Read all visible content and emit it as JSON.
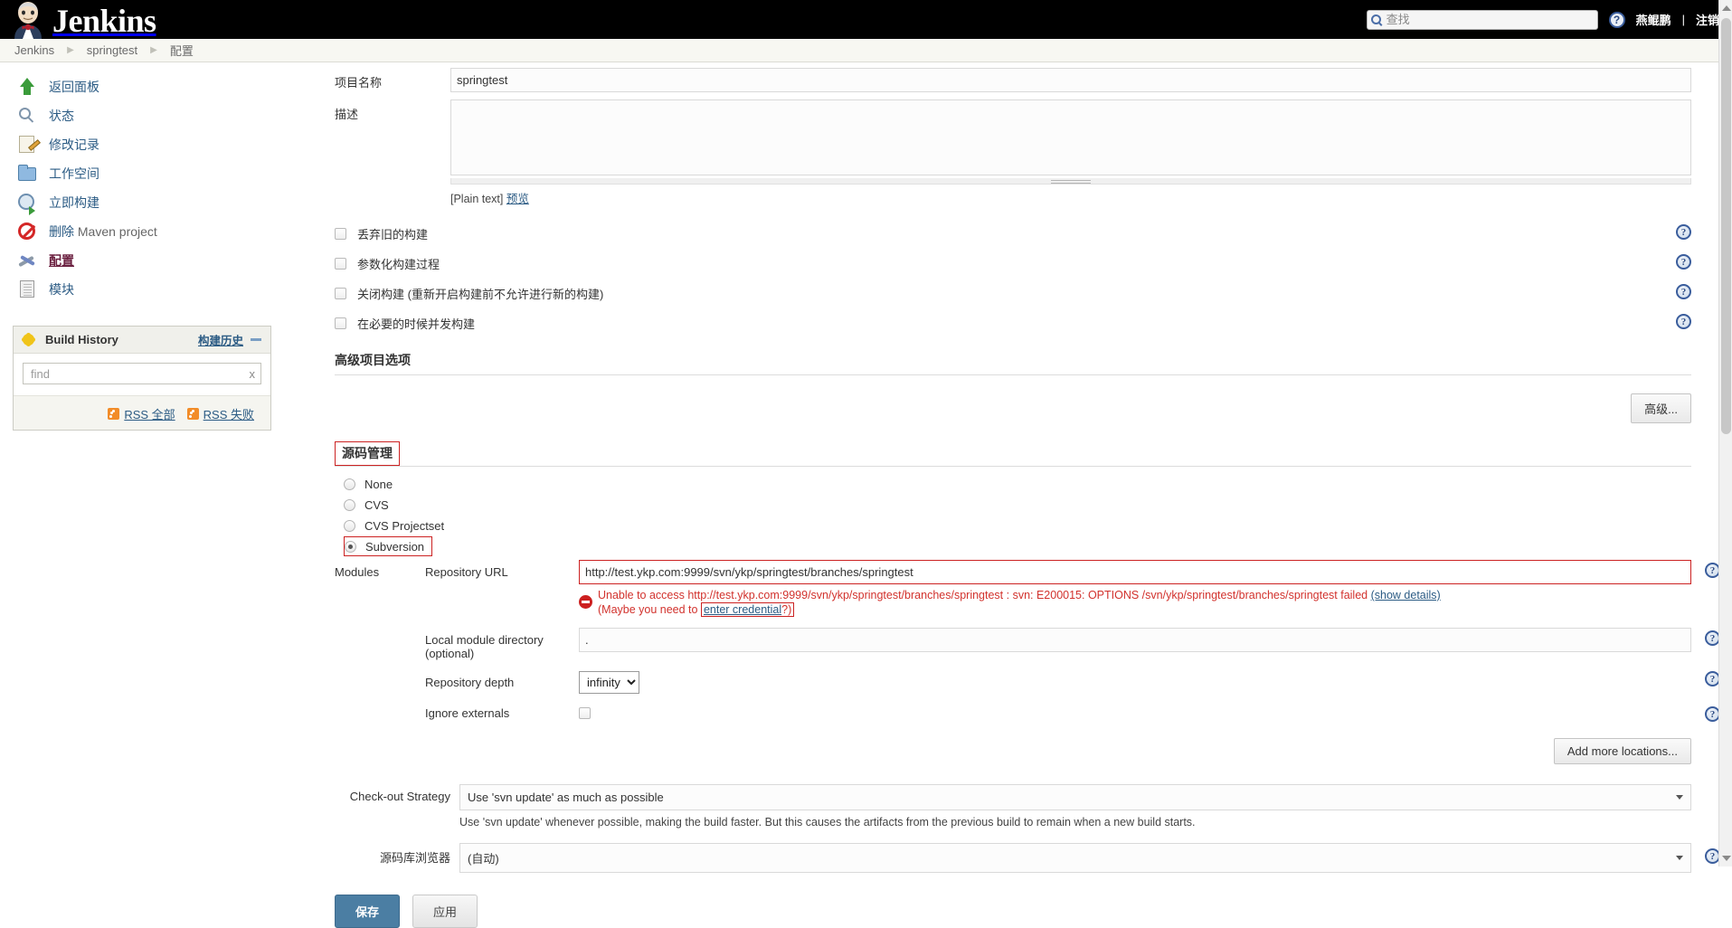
{
  "header": {
    "brand": "Jenkins",
    "search_placeholder": "查找",
    "search_value": "",
    "help_icon": "help-icon",
    "user": "燕鲲鹏",
    "separator": "|",
    "logout": "注销"
  },
  "breadcrumb": {
    "items": [
      "Jenkins",
      "springtest",
      "配置"
    ]
  },
  "sidebar": {
    "items": [
      {
        "label": "返回面板",
        "icon": "up-arrow-icon",
        "current": false
      },
      {
        "label": "状态",
        "icon": "search-icon",
        "current": false
      },
      {
        "label": "修改记录",
        "icon": "changes-icon",
        "current": false
      },
      {
        "label": "工作空间",
        "icon": "folder-icon",
        "current": false
      },
      {
        "label": "立即构建",
        "icon": "build-now-icon",
        "current": false
      },
      {
        "label": "删除",
        "sub": "Maven project",
        "icon": "delete-icon",
        "current": false
      },
      {
        "label": "配置",
        "icon": "wrench-icon",
        "current": true
      },
      {
        "label": "模块",
        "icon": "module-icon",
        "current": false
      }
    ],
    "build_history": {
      "title": "Build History",
      "link": "构建历史",
      "find_placeholder": "find",
      "find_value": "",
      "clear_label": "x",
      "rss_all": "RSS 全部",
      "rss_failed": "RSS 失败"
    }
  },
  "form": {
    "project_name_label": "项目名称",
    "project_name_value": "springtest",
    "description_label": "描述",
    "description_value": "",
    "plain_text_note": "[Plain text]",
    "preview_link": "预览",
    "checkboxes": [
      {
        "label": "丢弃旧的构建",
        "checked": false
      },
      {
        "label": "参数化构建过程",
        "checked": false
      },
      {
        "label": "关闭构建 (重新开启构建前不允许进行新的构建)",
        "checked": false
      },
      {
        "label": "在必要的时候并发构建",
        "checked": false
      }
    ],
    "advanced_section_title": "高级项目选项",
    "advanced_button": "高级...",
    "scm": {
      "title": "源码管理",
      "options": [
        {
          "label": "None",
          "selected": false
        },
        {
          "label": "CVS",
          "selected": false
        },
        {
          "label": "CVS Projectset",
          "selected": false
        },
        {
          "label": "Subversion",
          "selected": true
        }
      ],
      "modules_label": "Modules",
      "repository_url_label": "Repository URL",
      "repository_url_value": "http://test.ykp.com:9999/svn/ykp/springtest/branches/springtest",
      "error_text": "Unable to access http://test.ykp.com:9999/svn/ykp/springtest/branches/springtest : svn: E200015: OPTIONS /svn/ykp/springtest/branches/springtest failed",
      "error_details_link": "(show details)",
      "error_credential_prefix": "(Maybe you need to ",
      "error_credential_link": "enter credential",
      "error_credential_suffix": "?)",
      "local_module_label": "Local module directory (optional)",
      "local_module_value": ".",
      "repository_depth_label": "Repository depth",
      "repository_depth_value": "infinity",
      "ignore_externals_label": "Ignore externals",
      "ignore_externals_checked": false,
      "add_more_locations": "Add more locations..."
    },
    "checkout_strategy_label": "Check-out Strategy",
    "checkout_strategy_value": "Use 'svn update' as much as possible",
    "checkout_strategy_hint": "Use 'svn update' whenever possible, making the build faster. But this causes the artifacts from the previous build to remain when a new build starts.",
    "repo_browser_label": "源码库浏览器",
    "repo_browser_value": "(自动)",
    "save_button": "保存",
    "apply_button": "应用",
    "help_icon_glyph": "?"
  },
  "colors": {
    "accent": "#2b5b84",
    "error": "#d2322d",
    "error_border": "#cc2222",
    "primary_button": "#4b7ea3",
    "topbar": "#000000"
  }
}
